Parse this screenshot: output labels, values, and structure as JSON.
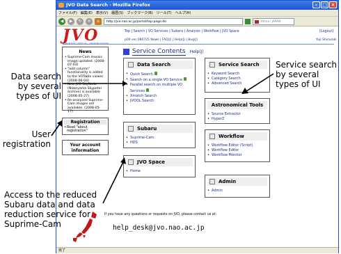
{
  "window": {
    "title": "JVO Data Search - Mozilla Firefox"
  },
  "menu": [
    "ファイル(F)",
    "編集(E)",
    "表示(V)",
    "履歴(S)",
    "ブックマーク(B)",
    "ツール(T)",
    "ヘルプ(H)"
  ],
  "toolbar": {
    "url": "http://jvo.nao.ac.jp/portal/top-page.do",
    "search_placeholder": "Yahoo! JAPAN"
  },
  "header": {
    "logo_text": "JVO",
    "logo_subtitle": "JAPANESE VIRTUAL OBSERVATORY",
    "nav_top": "Top | Search | VO Services | Subaru | Analysis | Workflow | JVO Space",
    "nav_sub": "p00 ver 080725   News | FAQ(J) | Help(J) | Bug(J)",
    "logout": "[Logout]",
    "user": "Yuji Shirasaki"
  },
  "news": {
    "title": "News",
    "items": [
      "Suprime-Cam mosaic image updated. (2008-07-03)",
      "\"add column\" functionality is added to the VOTable viewer (2008-06-04)",
      "New JVO SkyNode (Nobeyama Skypeter archive) is available (2008-05-27)",
      "Re-analyzed Suprime-Cam images are available. (2008-05-17)"
    ]
  },
  "registration": {
    "title": "Registration",
    "items": [
      "Read \"about registration\""
    ]
  },
  "account": {
    "label": "Your account information"
  },
  "service_contents": {
    "title": "Service Contents",
    "help": "Help(J)"
  },
  "panels": {
    "data_search": {
      "title": "Data Search",
      "items": [
        "Quick Search",
        "Search on a single VO Service",
        "Parallel search on multiple VO Services",
        "Xmatch Search",
        "JVOQL Search"
      ]
    },
    "service_search": {
      "title": "Service Search",
      "items": [
        "Keyword Search",
        "Category Search",
        "Advanced Search"
      ]
    },
    "subaru": {
      "title": "Subaru",
      "items": [
        "Suprime-Cam",
        "HDS"
      ]
    },
    "tools": {
      "title": "Astronomical Tools",
      "items": [
        "Source Extractor",
        "HyperZ"
      ]
    },
    "workflow": {
      "title": "Workflow",
      "items": [
        "Workflow Editor (Script)",
        "Workflow Editor",
        "Workflow Monitor"
      ]
    },
    "jvo_space": {
      "title": "JVO Space",
      "items": [
        "Home"
      ]
    },
    "admin": {
      "title": "Admin",
      "items": [
        "Admin"
      ]
    }
  },
  "footer": {
    "contact": "If you have any questions or requests on JVO, please contact us at:",
    "email": "help_desk@jvo.nao.ac.jp",
    "status": "完了"
  },
  "annotations": {
    "data_search": "Data search by several types of UI",
    "service_search": "Service search by several types of UI",
    "user_registration": "User registration",
    "subaru": "Access to the reduced Subaru data and data reduction service for Suprime-Cam"
  }
}
